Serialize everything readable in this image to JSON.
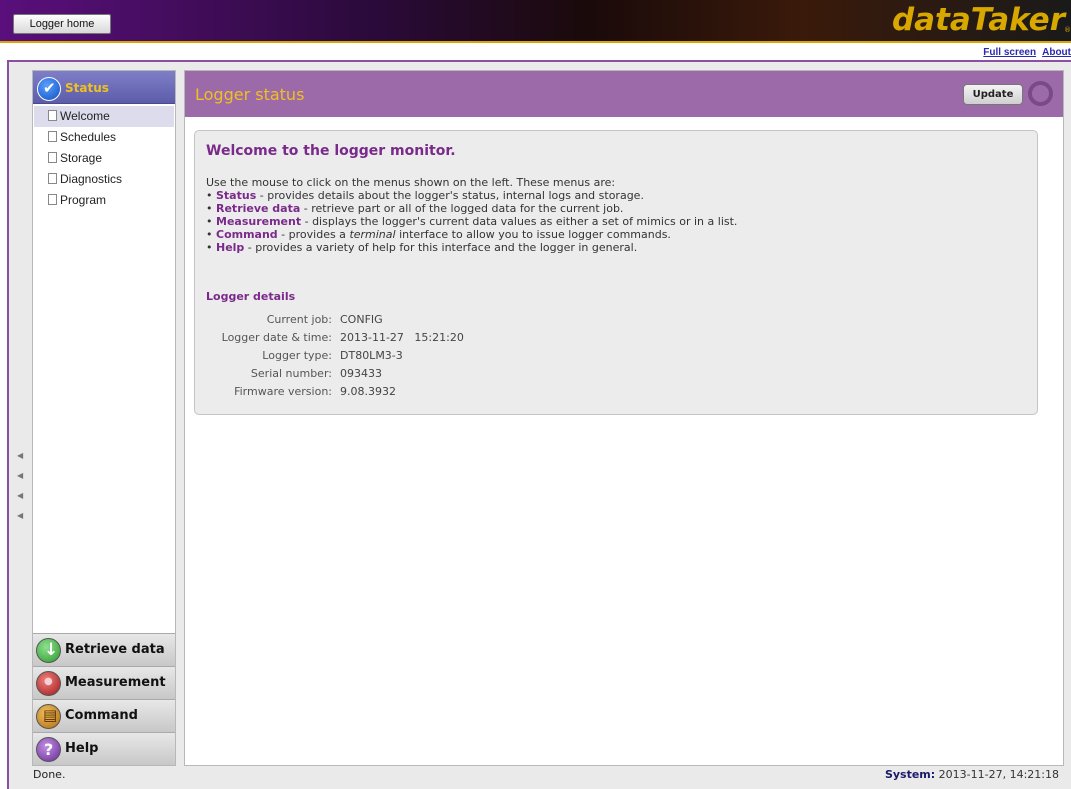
{
  "header": {
    "home_button": "Logger home",
    "logo_text": "dataTaker",
    "logo_mark": "®",
    "links": {
      "full_screen": "Full screen",
      "about": "About"
    }
  },
  "sidebar": {
    "status": {
      "label": "Status",
      "items": [
        {
          "label": "Welcome",
          "active": true
        },
        {
          "label": "Schedules"
        },
        {
          "label": "Storage"
        },
        {
          "label": "Diagnostics"
        },
        {
          "label": "Program"
        }
      ]
    },
    "sections": [
      {
        "label": "Retrieve data",
        "icon": "download-icon"
      },
      {
        "label": "Measurement",
        "icon": "gauge-icon"
      },
      {
        "label": "Command",
        "icon": "terminal-icon"
      },
      {
        "label": "Help",
        "icon": "help-icon"
      }
    ]
  },
  "main": {
    "title": "Logger status",
    "update_button": "Update",
    "welcome": {
      "heading": "Welcome to the logger monitor.",
      "intro": "Use the mouse to click on the menus shown on the left. These menus are:",
      "bullets": [
        {
          "name": "Status",
          "text": " - provides details about the logger's status, internal logs and storage."
        },
        {
          "name": "Retrieve data",
          "text": " - retrieve part or all of the logged data for the current job."
        },
        {
          "name": "Measurement",
          "text": " - displays the logger's current data values as either a set of mimics or in a list."
        },
        {
          "name": "Command",
          "text_before": " - provides a ",
          "emph": "terminal",
          "text_after": " interface to allow you to issue logger commands."
        },
        {
          "name": "Help",
          "text": " - provides a variety of help for this interface and the logger in general."
        }
      ]
    },
    "details": {
      "heading": "Logger details",
      "rows": [
        {
          "label": "Current job:",
          "value": "CONFIG"
        },
        {
          "label": "Logger date & time:",
          "value": "2013-11-27   15:21:20"
        },
        {
          "label": "Logger type:",
          "value": "DT80LM3-3"
        },
        {
          "label": "Serial number:",
          "value": "093433"
        },
        {
          "label": "Firmware version:",
          "value": "9.08.3932"
        }
      ]
    }
  },
  "statusbar": {
    "left": "Done.",
    "system_label": "System:",
    "system_value": "2013-11-27, 14:21:18"
  },
  "colors": {
    "accent_purple": "#9c6aa8",
    "heading_purple": "#7a2a8a",
    "gold": "#d8a800",
    "status_blue": "#5c5caa"
  }
}
